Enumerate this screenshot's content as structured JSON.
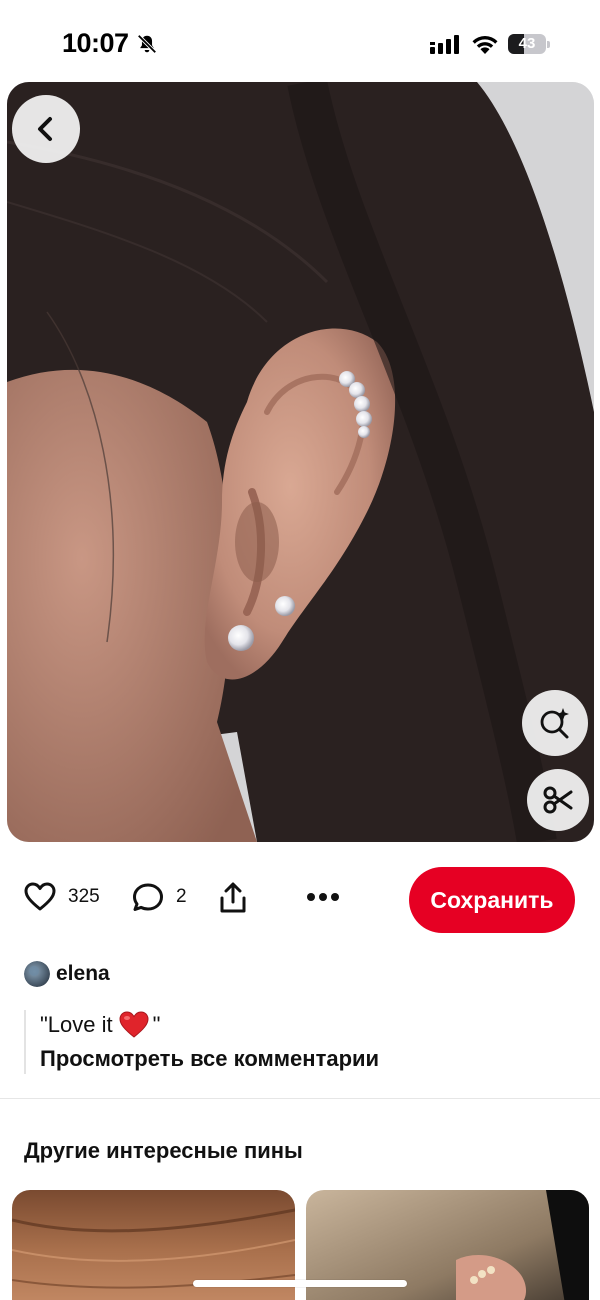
{
  "status_bar": {
    "time": "10:07",
    "battery_level": "43",
    "battery_fraction": 0.43,
    "icons": [
      "bell-slash-icon",
      "signal-icon",
      "wifi-icon",
      "battery-icon"
    ]
  },
  "pin": {
    "image_subject": "ear-piercing-photo",
    "buttons": {
      "back_icon": "chevron-left-icon",
      "visual_search_icon": "lens-sparkle-icon",
      "cutout_icon": "scissors-icon"
    }
  },
  "actions": {
    "like_count": "325",
    "comment_count": "2",
    "save_label": "Сохранить",
    "save_color": "#e60023"
  },
  "comment": {
    "author": "elena",
    "text_before": "\"Love it",
    "text_after": "\"",
    "emoji": "heart-emoji",
    "view_all_label": "Просмотреть все комментарии"
  },
  "more_pins": {
    "title": "Другие интересные пины"
  }
}
